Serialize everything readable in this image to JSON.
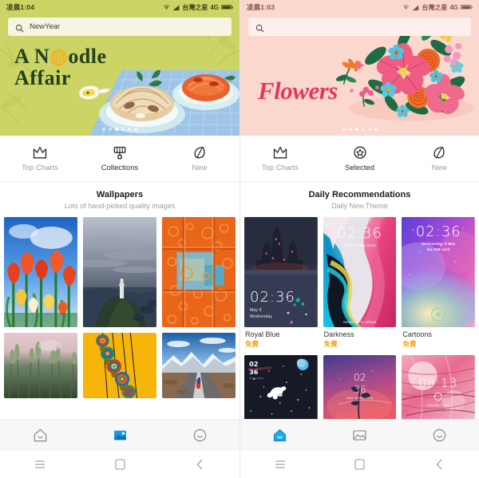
{
  "left": {
    "status": {
      "time": "凌晨1:04",
      "carrier": "台灣之星",
      "network": "4G",
      "wifi_icon": "wifi-icon",
      "signal_icon": "signal-bars-icon",
      "battery_icon": "battery-icon"
    },
    "search": {
      "value": "NewYear",
      "placeholder": "",
      "icon": "search-icon"
    },
    "banner": {
      "title_line1": "A N●odle",
      "title_line2": "Affair",
      "title_plain": "A Noodle Affair",
      "bg_color": "#cbd464",
      "art": "noodle-bowls-illustration",
      "dots_total": 6,
      "dots_active": 3
    },
    "tabs": [
      {
        "label": "Top Charts",
        "icon": "crown-icon",
        "active": false
      },
      {
        "label": "Collections",
        "icon": "paint-roller-icon",
        "active": true
      },
      {
        "label": "New",
        "icon": "leaf-icon",
        "active": false
      }
    ],
    "section": {
      "title": "Wallpapers",
      "subtitle": "Lots of hand-picked quality images"
    },
    "grid_row1": [
      {
        "name": "red-tulips-blue-sky"
      },
      {
        "name": "lighthouse-stormy-coast"
      },
      {
        "name": "orange-industrial-abstract"
      }
    ],
    "grid_row2": [
      {
        "name": "wheat-field-pink-sky"
      },
      {
        "name": "turkish-lamps-yellow"
      },
      {
        "name": "mountain-road-highway"
      }
    ],
    "bottomnav": [
      {
        "icon": "home-icon",
        "active": false
      },
      {
        "icon": "wallpaper-image-icon",
        "active": true
      },
      {
        "icon": "smiley-face-icon",
        "active": false
      }
    ]
  },
  "right": {
    "status": {
      "time": "凌晨1:03",
      "carrier": "台灣之星",
      "network": "4G",
      "wifi_icon": "wifi-icon",
      "signal_icon": "signal-bars-icon",
      "battery_icon": "battery-icon"
    },
    "search": {
      "value": "",
      "placeholder": "",
      "icon": "search-icon"
    },
    "banner": {
      "title_plain": "Flowers",
      "bg_color": "#fad8ce",
      "art": "floral-bouquet-illustration",
      "dots_total": 6,
      "dots_active": 3
    },
    "tabs": [
      {
        "label": "Top Charts",
        "icon": "crown-icon",
        "active": false
      },
      {
        "label": "Selected",
        "icon": "star-circle-icon",
        "active": true
      },
      {
        "label": "New",
        "icon": "leaf-icon",
        "active": false
      }
    ],
    "section": {
      "title": "Daily Recommendations",
      "subtitle": "Daily New Theme"
    },
    "themes_row1": [
      {
        "name": "Royal Blue",
        "price": "免費",
        "clock": "02:36",
        "date_line1": "May        9",
        "date_line2": "Wednesday",
        "art": "dark-castle-lake"
      },
      {
        "name": "Darkness",
        "price": "免費",
        "clock": "02:36",
        "date_line1": "Wed 09 May 2018",
        "date_line2": "Swipe up to unlock",
        "art": "pink-blue-fluid-abstract"
      },
      {
        "name": "Cartoons",
        "price": "免費",
        "clock": "02:36",
        "date_line1": "Wednesday, 9 May",
        "date_line2": "No SIM card",
        "art": "purple-rainbow-gradient"
      }
    ],
    "themes_row2": [
      {
        "clock_line1": "02",
        "clock_line2": "36",
        "art": "astronaut-space-night"
      },
      {
        "clock_line1": "02",
        "clock_line2": "36",
        "art": "pink-purple-gradient-plant"
      },
      {
        "clock_line1": "08:13",
        "clock_line2": "",
        "art": "pink-leaf-macro"
      }
    ],
    "price_color": "#f5a623",
    "bottomnav": [
      {
        "icon": "home-icon",
        "active": true
      },
      {
        "icon": "wallpaper-image-icon",
        "active": false
      },
      {
        "icon": "smiley-face-icon",
        "active": false
      }
    ]
  },
  "androidnav": {
    "menu_icon": "menu-icon",
    "home_icon": "home-square-icon",
    "back_icon": "back-chevron-icon"
  }
}
